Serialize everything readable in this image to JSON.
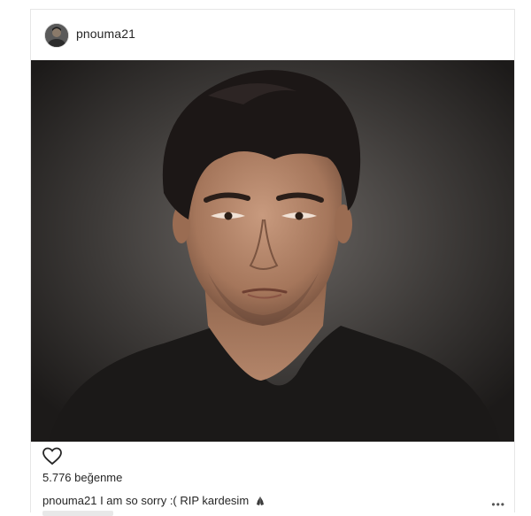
{
  "post": {
    "username": "pnouma21",
    "avatar_icon": "profile-avatar",
    "photo_subject": "",
    "likes_text": "5.776 beğenme",
    "caption_user": "pnouma21",
    "caption_text": "I am so sorry :( RIP kardesim",
    "caption_emoji_icon": "praying-hands-icon",
    "more_icon": "ellipsis-icon",
    "like_icon": "heart-outline-icon"
  },
  "colors": {
    "text": "#262626",
    "border": "#e6e6e6",
    "photo_background": "#2a2725"
  }
}
